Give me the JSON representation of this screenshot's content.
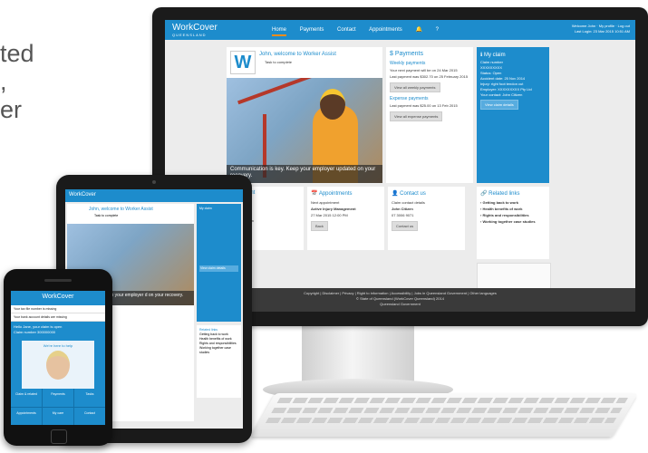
{
  "background_text": [
    "ted",
    ",",
    "er"
  ],
  "desktop": {
    "logo": "WorkCover",
    "logo_sub": "QUEENSLAND",
    "nav": [
      "Home",
      "Payments",
      "Contact",
      "Appointments"
    ],
    "user_line1": "Welcome John · My profile · Log out",
    "user_line2": "Last Login: 23 Mar 2015 10:51 AM",
    "welcome": "John, welcome to Worker Assist",
    "task": "Task to complete",
    "caption": "Communication is key. Keep your employer updated on your recovery.",
    "payments": {
      "title": "Payments",
      "weekly_title": "Weekly payments",
      "weekly_next": "Your next payment will be on 24 Mar 2015",
      "weekly_last": "Last payment was $302.70 on 25 February 2015",
      "weekly_btn": "View all weekly payments",
      "expense_title": "Expense payments",
      "expense_last": "Last payment was $25.00 on 13 Feb 2015",
      "expense_btn": "View all expense payments"
    },
    "my_claim": {
      "title": "My claim",
      "number_label": "Claim number",
      "number": "XXXXXXXXX",
      "status": "Status: Open",
      "accident": "Accident date: 25 Nov 2014",
      "injury": "Injury: right foot tendon cut",
      "employer": "Employer: XXXXXXXXX Pty Ltd",
      "contact": "Your contact: John Citizen",
      "btn": "View claim details"
    },
    "document": {
      "title": "Document",
      "lines": [
        "ate",
        "mbursement",
        "mer)",
        "y of your claim"
      ]
    },
    "appointments": {
      "title": "Appointments",
      "label": "Next appointment",
      "name": "Active Injury Management",
      "date": "27 Mar 2015 12:00 PM",
      "btn": "Back"
    },
    "contact": {
      "title": "Contact us",
      "label": "Claim contact details",
      "name": "John Citizen",
      "phone": "07 3006 9071",
      "btn": "Contact us"
    },
    "related": {
      "title": "Related links",
      "items": [
        "Getting back to work",
        "Health benefits of work",
        "Rights and responsibilities",
        "Working together case studies"
      ]
    },
    "footer1": "Copyright | Disclaimer | Privacy | Right to information | Accessibility | Jobs in Queensland Government | Other languages",
    "footer2": "© State of Queensland (WorkCover Queensland) 2014",
    "footer3": "Queensland Government"
  },
  "tablet": {
    "logo": "WorkCover",
    "welcome": "John, welcome to Worker Assist",
    "task": "Task to complete",
    "caption": "unication is key. Keep your employer d on your recovery.",
    "claim": "My claim",
    "related": "Related links",
    "related_items": [
      "Getting back to work",
      "Health benefits of work",
      "Rights and responsibilities",
      "Working together case studies"
    ],
    "claim_btn": "View claim details"
  },
  "phone": {
    "logo": "WorkCover",
    "alert1": "Your tax file number is missing",
    "alert2": "Your bank account details are missing",
    "hello": "Hello Jane, your claim is open",
    "claim_number": "Claim number 300000000",
    "help_title": "We're here to help",
    "tiles": [
      "Claim & related",
      "Payments",
      "Tasks",
      "Appointments",
      "My care",
      "Contact"
    ]
  }
}
